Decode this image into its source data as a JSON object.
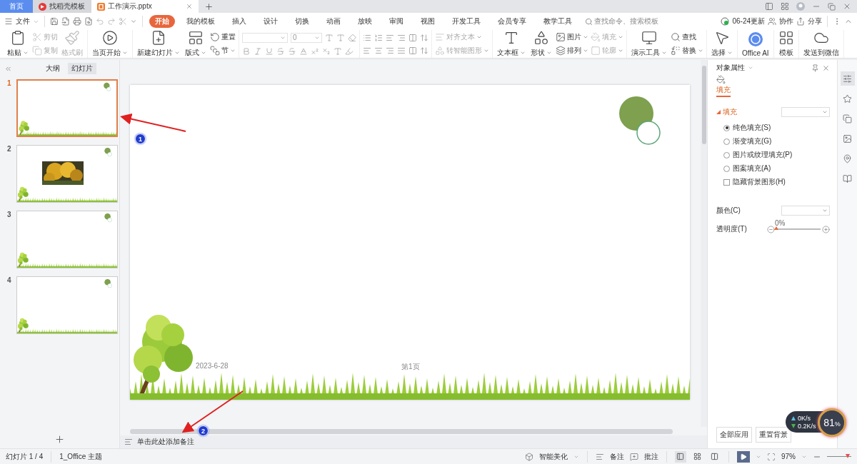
{
  "title_bar": {
    "tabs": [
      {
        "label": "首页",
        "kind": "home",
        "selected": false
      },
      {
        "label": "找稻壳模板",
        "kind": "docer",
        "selected": false
      },
      {
        "label": "工作演示.pptx",
        "kind": "doc",
        "selected": true
      }
    ]
  },
  "menu": {
    "file": "文件",
    "tabs": [
      {
        "label": "开始",
        "selected": true
      },
      {
        "label": "我的模板",
        "selected": false
      },
      {
        "label": "插入",
        "selected": false
      },
      {
        "label": "设计",
        "selected": false
      },
      {
        "label": "切换",
        "selected": false
      },
      {
        "label": "动画",
        "selected": false
      },
      {
        "label": "放映",
        "selected": false
      },
      {
        "label": "审阅",
        "selected": false
      },
      {
        "label": "视图",
        "selected": false
      },
      {
        "label": "开发工具",
        "selected": false
      },
      {
        "label": "会员专享",
        "selected": false
      },
      {
        "label": "教学工具",
        "selected": false
      }
    ],
    "search": {
      "placeholder": "查找命令、搜索模板"
    },
    "update": "06-24更新",
    "collab": "协作",
    "share": "分享"
  },
  "ribbon": {
    "groups": [
      {
        "kind": "buttons",
        "items": [
          {
            "kind": "big",
            "label": "粘贴",
            "caret": true,
            "disabled": false
          },
          {
            "kind": "small",
            "label": "剪切",
            "caret": false,
            "disabled": true
          },
          {
            "kind": "small",
            "label": "复制",
            "caret": false,
            "disabled": true
          },
          {
            "kind": "big",
            "label": "格式刷",
            "caret": false,
            "disabled": true
          }
        ]
      },
      {
        "kind": "buttons",
        "items": [
          {
            "kind": "big",
            "label": "当页开始",
            "caret": true,
            "disabled": false
          }
        ]
      },
      {
        "kind": "buttons",
        "items": [
          {
            "kind": "big",
            "label": "新建幻灯片",
            "caret": true,
            "disabled": false
          },
          {
            "kind": "big",
            "label": "版式",
            "caret": true,
            "disabled": false
          },
          {
            "kind": "small",
            "label": "重置",
            "caret": false,
            "disabled": false
          },
          {
            "kind": "small",
            "label": "节",
            "caret": true,
            "disabled": false
          }
        ]
      },
      {
        "kind": "font",
        "size": "0"
      },
      {
        "kind": "paragraph"
      },
      {
        "kind": "buttons",
        "items": [
          {
            "kind": "small",
            "label": "对齐文本",
            "caret": true,
            "disabled": true
          },
          {
            "kind": "small",
            "label": "转智能图形",
            "caret": true,
            "disabled": true
          }
        ]
      },
      {
        "kind": "buttons",
        "items": [
          {
            "kind": "big",
            "label": "文本框",
            "caret": true,
            "disabled": false
          },
          {
            "kind": "big",
            "label": "形状",
            "caret": true,
            "disabled": false
          },
          {
            "kind": "small",
            "label": "图片",
            "caret": true,
            "disabled": false
          },
          {
            "kind": "small",
            "label": "排列",
            "caret": true,
            "disabled": false
          },
          {
            "kind": "small",
            "label": "填充",
            "caret": true,
            "disabled": true
          },
          {
            "kind": "small",
            "label": "轮廓",
            "caret": true,
            "disabled": true
          }
        ]
      },
      {
        "kind": "buttons",
        "items": [
          {
            "kind": "big",
            "label": "演示工具",
            "caret": true,
            "disabled": false
          },
          {
            "kind": "small",
            "label": "查找",
            "caret": false,
            "disabled": false
          },
          {
            "kind": "small",
            "label": "替换",
            "caret": true,
            "disabled": false
          }
        ]
      },
      {
        "kind": "buttons",
        "items": [
          {
            "kind": "big",
            "label": "选择",
            "caret": true,
            "disabled": false
          }
        ]
      },
      {
        "kind": "buttons",
        "items": [
          {
            "kind": "big",
            "label": "Office AI",
            "caret": false,
            "disabled": false
          }
        ]
      },
      {
        "kind": "buttons",
        "items": [
          {
            "kind": "big",
            "label": "模板",
            "caret": false,
            "disabled": false
          }
        ]
      },
      {
        "kind": "buttons",
        "items": [
          {
            "kind": "big",
            "label": "发送到微信",
            "caret": false,
            "disabled": false
          }
        ]
      }
    ]
  },
  "left_panel": {
    "tabs": [
      {
        "label": "大纲",
        "selected": false
      },
      {
        "label": "幻灯片",
        "selected": true
      }
    ],
    "slides": [
      {
        "number": "1",
        "selected": true,
        "has_picture": false
      },
      {
        "number": "2",
        "selected": false,
        "has_picture": true
      },
      {
        "number": "3",
        "selected": false,
        "has_picture": false
      },
      {
        "number": "4",
        "selected": false,
        "has_picture": false
      }
    ]
  },
  "slide": {
    "date": "2023-6-28",
    "page": "第1页"
  },
  "notes": {
    "placeholder": "单击此处添加备注"
  },
  "annotations": [
    {
      "label": "1"
    },
    {
      "label": "2"
    }
  ],
  "right_panel": {
    "title": "对象属性",
    "tab": "填充",
    "section": "填充",
    "fill_options": [
      {
        "label": "纯色填充(S)",
        "selected": true
      },
      {
        "label": "渐变填充(G)",
        "selected": false
      },
      {
        "label": "图片或纹理填充(P)",
        "selected": false
      },
      {
        "label": "图案填充(A)",
        "selected": false
      }
    ],
    "hide_background": {
      "label": "隐藏背景图形(H)",
      "checked": false
    },
    "color_label": "颜色(C)",
    "transparency": {
      "label": "透明度(T)",
      "level": 0,
      "reading": "0%"
    },
    "buttons": [
      "全部应用",
      "重置背景"
    ]
  },
  "status_bar": {
    "slide_info": "幻灯片 1 / 4",
    "theme": "1_Office 主题",
    "beautify": "智能美化",
    "notes": "备注",
    "comments": "批注",
    "zoom": "97%",
    "views": [
      {
        "selected": true
      },
      {
        "selected": false
      },
      {
        "selected": false
      }
    ],
    "zoom_slider": {
      "level": 0.85
    }
  },
  "net_widget": {
    "upload": "0K/s",
    "download": "0.2K/s",
    "percent": "81",
    "percent_sign": "%"
  }
}
